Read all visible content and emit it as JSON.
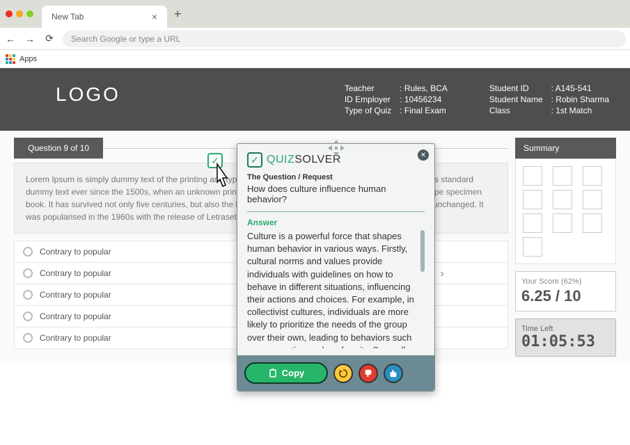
{
  "browser": {
    "tab_title": "New Tab",
    "url_placeholder": "Search Google or type a URL",
    "apps_label": "Apps"
  },
  "header": {
    "logo": "LOGO",
    "left": {
      "teacher_label": "Teacher",
      "teacher_value": ": Rules, BCA",
      "idemp_label": "ID Employer",
      "idemp_value": ": 10456234",
      "type_label": "Type of Quiz",
      "type_value": ": Final Exam"
    },
    "right": {
      "sid_label": "Student ID",
      "sid_value": ": A145-541",
      "sname_label": "Student Name",
      "sname_value": ": Robin Sharma",
      "class_label": "Class",
      "class_value": ": 1st Match"
    }
  },
  "quiz": {
    "question_tab": "Question 9 of 10",
    "question_text": "Lorem Ipsum is simply dummy text of the printing and typesetting industry. Lorem Ipsum has been the industry's standard dummy text ever since the 1500s, when an unknown printer took a galley of type and scrambled it to make a type specimen book. It has survived not only five centuries, but also the leap into electronic typesetting, remaining essentially unchanged. It was popularised in the 1960s with the release of Letraset sheets containing Lorem Ipsum passages",
    "options": [
      "Contrary to popular",
      "Contrary to popular",
      "Contrary to popular",
      "Contrary to popular",
      "Contrary to popular"
    ]
  },
  "summary": {
    "title": "Summary",
    "score_label": "Your Score (62%)",
    "score_value": "6.25 / 10",
    "time_label": "Time Left",
    "time_value": "01:05:53"
  },
  "popup": {
    "brand_q": "QUIZ",
    "brand_s": "SOLVER",
    "req_label": "The Question / Request",
    "req_text": "How does culture influence human behavior?",
    "ans_label": "Answer",
    "ans_text": "Culture is a powerful force that shapes human behavior in various ways. Firstly, cultural norms and values provide individuals with guidelines on how to behave in different situations, influencing their actions and choices. For example, in collectivist cultures, individuals are more likely to prioritize the needs of the group over their own, leading to behaviors such as cooperation and conformity. Secondly",
    "copy_label": "Copy"
  }
}
